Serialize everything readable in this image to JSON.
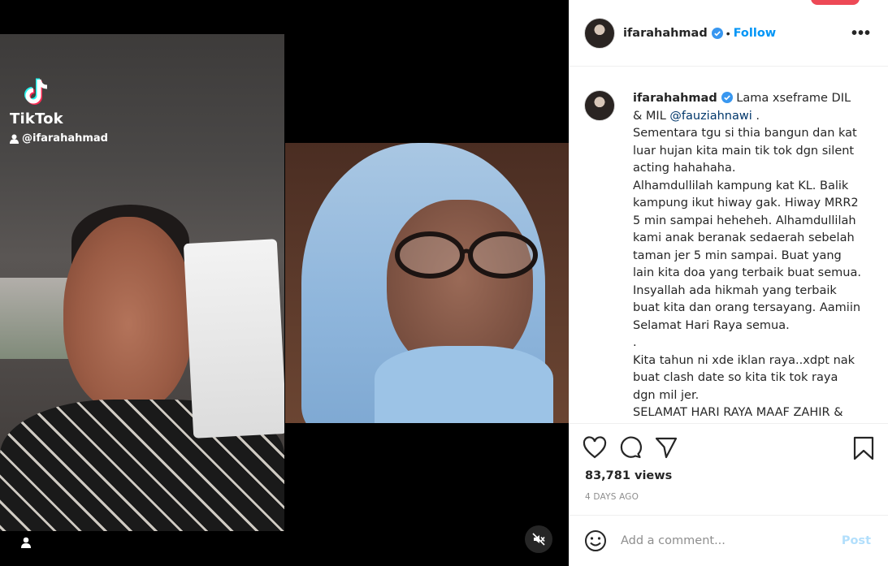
{
  "media": {
    "tiktok_wordmark": "TikTok",
    "tiktok_handle": "@ifarahahmad"
  },
  "post": {
    "username": "ifarahahmad",
    "follow_label": "Follow",
    "separator": "•",
    "more_label": "•••",
    "caption": {
      "username": "ifarahahmad",
      "first_line": " Lama xseframe DIL & MIL ",
      "mention": "@fauziahnawi",
      "mention_after": " .",
      "lines": [
        "Sementara tgu si thia bangun dan kat luar hujan kita main tik tok dgn silent acting hahahaha.",
        "Alhamdullilah kampung kat KL. Balik kampung ikut hiway gak. Hiway MRR2 5 min sampai heheheh. Alhamdullilah kami anak beranak sedaerah sebelah taman jer 5 min sampai. Buat yang lain kita doa yang terbaik buat semua. Insyallah ada hikmah yang terbaik buat kita dan orang tersayang. Aamiin",
        "Selamat Hari Raya semua.",
        ".",
        "Kita tahun ni xde iklan raya..xdpt nak buat clash date so kita tik tok raya dgn mil jer.",
        "SELAMAT HARI RAYA MAAF ZAHIR & BATIN SEMUA"
      ]
    },
    "views": "83,781 views",
    "posted": "4 DAYS AGO",
    "comment_placeholder": "Add a comment...",
    "post_label": "Post"
  },
  "colors": {
    "link_blue": "#0095f6",
    "mention_blue": "#00376b",
    "muted": "#8e8e8e",
    "post_disabled": "#b2dffc"
  },
  "icons": [
    "tiktok-logo-icon",
    "user-icon",
    "verified-icon",
    "more-icon",
    "heart-icon",
    "comment-icon",
    "share-icon",
    "bookmark-icon",
    "emoji-icon",
    "mute-icon"
  ]
}
